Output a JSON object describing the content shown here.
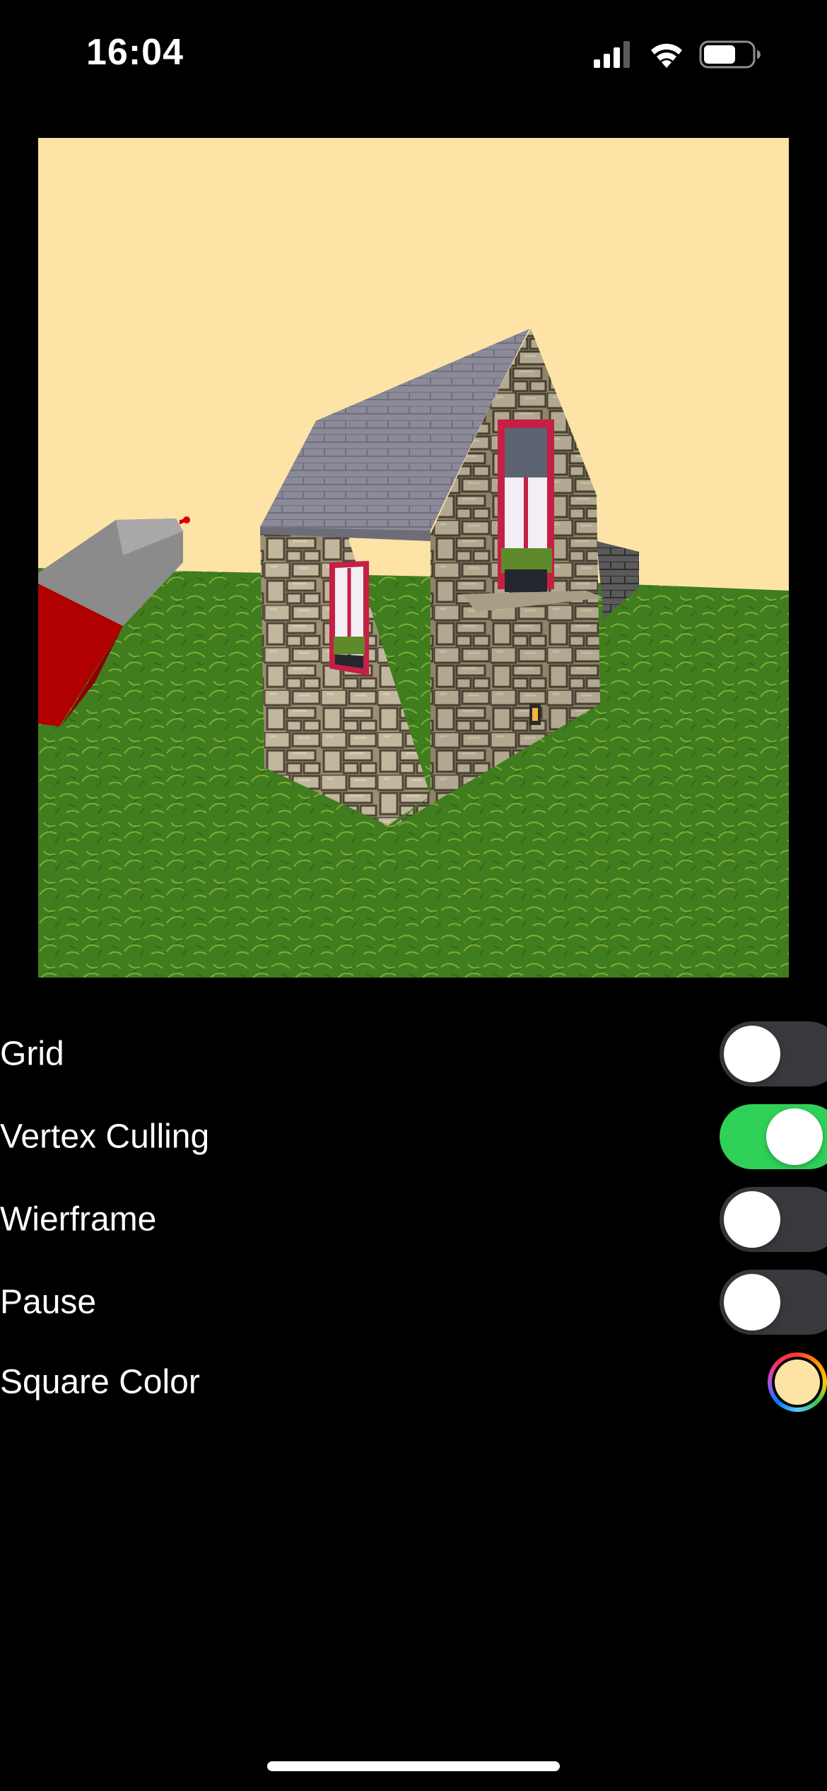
{
  "status_bar": {
    "time": "16:04",
    "icons": [
      "cellular-signal-icon",
      "wifi-icon",
      "battery-icon"
    ]
  },
  "viewport": {
    "sky_color": "#fde3a6",
    "ground_color": "#3f7d1e",
    "objects": [
      "stone-house",
      "rocket",
      "wall"
    ]
  },
  "settings": {
    "grid": {
      "label": "Grid",
      "on": false
    },
    "vertex_culling": {
      "label": "Vertex Culling",
      "on": true
    },
    "wireframe": {
      "label": "Wierframe",
      "on": false
    },
    "pause": {
      "label": "Pause",
      "on": false
    },
    "square_color": {
      "label": "Square Color",
      "color": "#fde3a6"
    }
  },
  "colors": {
    "toggle_on": "#30d158",
    "toggle_off": "#39393d"
  }
}
